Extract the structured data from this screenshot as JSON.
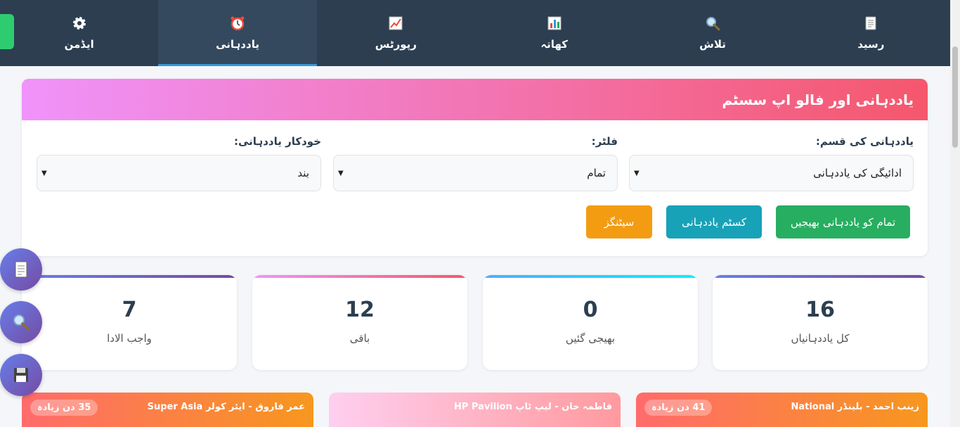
{
  "nav": {
    "items": [
      {
        "label": "رسید",
        "icon": "document-icon"
      },
      {
        "label": "تلاش",
        "icon": "magnifier-icon"
      },
      {
        "label": "کھاتہ",
        "icon": "bar-chart-icon"
      },
      {
        "label": "رپورٹس",
        "icon": "line-chart-icon"
      },
      {
        "label": "یاددہانی",
        "icon": "alarm-clock-icon"
      },
      {
        "label": "ایڈمن",
        "icon": "gear-icon"
      }
    ],
    "active": "یاددہانی"
  },
  "panel": {
    "title": "یاددہانی اور فالو اپ سسٹم",
    "filters": [
      {
        "label": "یاددہانی کی قسم:",
        "value": "ادائیگی کی یاددہانی"
      },
      {
        "label": "فلٹر:",
        "value": "تمام"
      },
      {
        "label": "خودکار یاددہانی:",
        "value": "بند"
      }
    ],
    "buttons": {
      "send_all": "تمام کو یاددہانی بھیجیں",
      "custom": "کسٹم یاددہانی",
      "settings": "سیٹنگز"
    }
  },
  "stats": [
    {
      "value": "16",
      "label": "کل یاددہانیاں"
    },
    {
      "value": "0",
      "label": "بھیجی گئیں"
    },
    {
      "value": "12",
      "label": "باقی"
    },
    {
      "value": "7",
      "label": "واجب الادا"
    }
  ],
  "reminders": [
    {
      "title": "زینب احمد - بلینڈر National",
      "badge": "41 دن زیادہ"
    },
    {
      "title": "فاطمہ خان - لیپ ٹاپ HP Pavilion",
      "badge": ""
    },
    {
      "title": "عمر فاروق - ایئر کولر Super Asia",
      "badge": "35 دن زیادہ"
    }
  ],
  "floating": [
    {
      "icon": "document-icon"
    },
    {
      "icon": "magnifier-icon"
    },
    {
      "icon": "floppy-disk-icon"
    }
  ],
  "colors": {
    "nav_bg": "#2c3e50",
    "nav_active": "#34495e",
    "accent_blue": "#3498db",
    "green": "#27ae60",
    "teal": "#17a2b8",
    "orange": "#f39c12"
  }
}
